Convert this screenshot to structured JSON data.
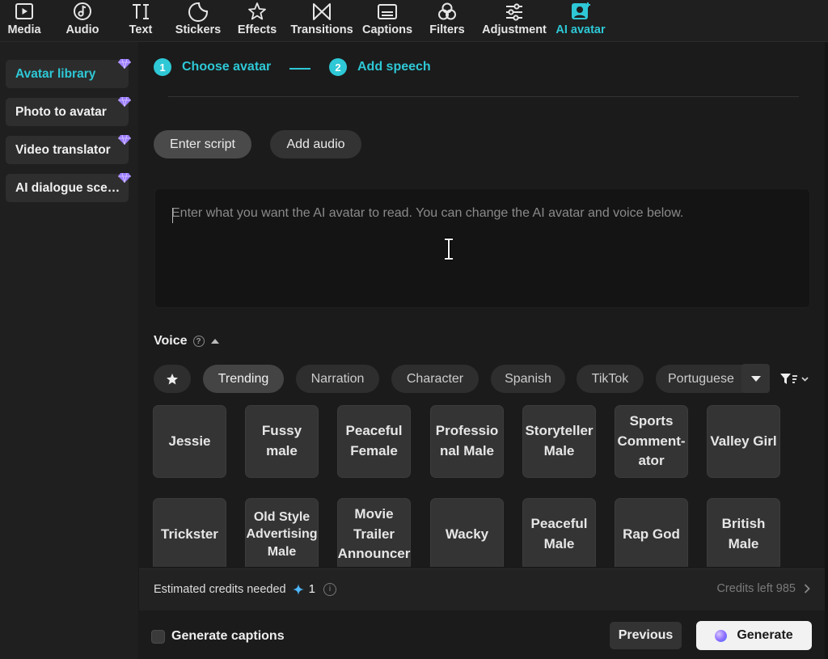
{
  "toolbar": {
    "tabs": [
      {
        "label": "Media",
        "icon": "media-icon"
      },
      {
        "label": "Audio",
        "icon": "audio-icon"
      },
      {
        "label": "Text",
        "icon": "text-icon"
      },
      {
        "label": "Stickers",
        "icon": "stickers-icon"
      },
      {
        "label": "Effects",
        "icon": "effects-icon"
      },
      {
        "label": "Transitions",
        "icon": "transitions-icon"
      },
      {
        "label": "Captions",
        "icon": "captions-icon"
      },
      {
        "label": "Filters",
        "icon": "filters-icon"
      },
      {
        "label": "Adjustment",
        "icon": "adjustment-icon"
      },
      {
        "label": "AI avatar",
        "icon": "ai-avatar-icon",
        "active": true
      }
    ],
    "accent_color": "#2ec8d6"
  },
  "sidebar": {
    "items": [
      {
        "label": "Avatar library",
        "active": true,
        "premium": true
      },
      {
        "label": "Photo to avatar",
        "premium": true
      },
      {
        "label": "Video translator",
        "premium": true
      },
      {
        "label": "AI dialogue scenes",
        "premium": true
      }
    ]
  },
  "steps": [
    {
      "num": "1",
      "label": "Choose avatar"
    },
    {
      "num": "2",
      "label": "Add speech"
    }
  ],
  "input_mode": {
    "enter_script": "Enter script",
    "add_audio": "Add audio",
    "selected": "enter_script"
  },
  "script": {
    "placeholder": "Enter what you want the AI avatar to read. You can change the AI avatar and voice below.",
    "value": ""
  },
  "voice": {
    "label": "Voice",
    "help": "?",
    "filters": [
      "Trending",
      "Narration",
      "Character",
      "Spanish",
      "TikTok",
      "Portuguese"
    ],
    "selected_filter": "Trending",
    "voices_row1": [
      "Jessie",
      "Fussy male",
      "Peaceful Female",
      "Professio nal Male",
      "Storyteller Male",
      "Sports Comment-ator",
      "Valley Girl"
    ],
    "voices_row2": [
      "Trickster",
      "Old Style Advertising Male",
      "Movie Trailer Announcer",
      "Wacky",
      "Peaceful Male",
      "Rap God",
      "British Male"
    ]
  },
  "credits": {
    "label": "Estimated credits needed",
    "needed": "1",
    "info": "i",
    "left_label": "Credits left",
    "left_value": "985"
  },
  "footer": {
    "generate_captions": "Generate captions",
    "generate_captions_checked": false,
    "previous": "Previous",
    "generate": "Generate"
  }
}
